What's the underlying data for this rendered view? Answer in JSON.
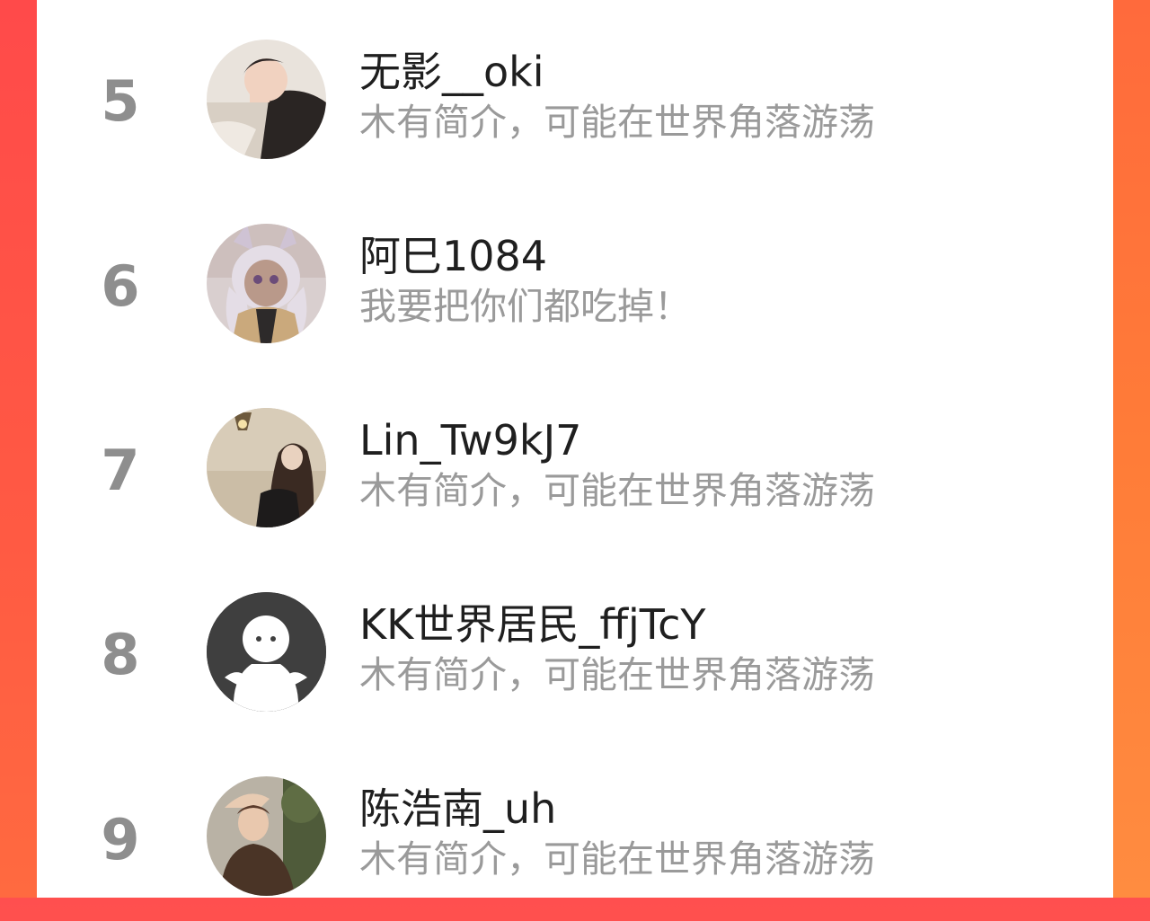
{
  "ranking_list": {
    "items": [
      {
        "rank": "5",
        "name": "无影__oki",
        "bio": "木有简介，可能在世界角落游荡",
        "avatar_icon": "photo-avatar-icon"
      },
      {
        "rank": "6",
        "name": "阿巳1084",
        "bio": "我要把你们都吃掉！",
        "avatar_icon": "anime-avatar-icon"
      },
      {
        "rank": "7",
        "name": "Lin_Tw9kJ7",
        "bio": "木有简介，可能在世界角落游荡",
        "avatar_icon": "photo-avatar-icon"
      },
      {
        "rank": "8",
        "name": "KK世界居民_ffjTcY",
        "bio": "木有简介，可能在世界角落游荡",
        "avatar_icon": "default-avatar-icon"
      },
      {
        "rank": "9",
        "name": "陈浩南_uh",
        "bio": "木有简介，可能在世界角落游荡",
        "avatar_icon": "photo-avatar-icon"
      }
    ]
  },
  "colors": {
    "background_gradient_start": "#ff4f4f",
    "background_gradient_end": "#ff8a3a",
    "panel": "#ffffff",
    "rank_text": "#8e8e8e",
    "name_text": "#1f1f1f",
    "bio_text": "#9a9a9a"
  }
}
